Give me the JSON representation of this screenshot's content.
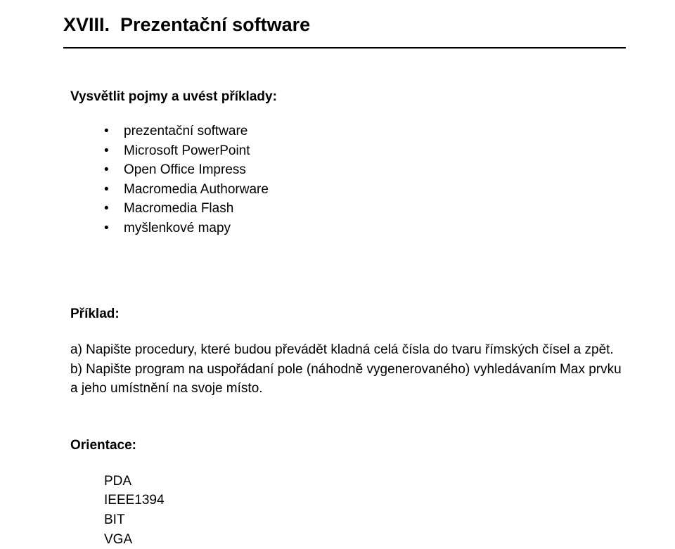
{
  "heading": "XVIII.  Prezentační software",
  "subheading": "Vysvětlit pojmy a uvést příklady:",
  "bullets": {
    "item0": "prezentační software",
    "item1": "Microsoft PowerPoint",
    "item2": "Open Office Impress",
    "item3": "Macromedia Authorware",
    "item4": "Macromedia Flash",
    "item5": "myšlenkové mapy"
  },
  "example": {
    "label": "Příklad:",
    "text_a": "a) Napište procedury, které budou převádět kladná celá čísla do tvaru římských čísel a zpět.",
    "text_b": "b) Napište program na uspořádaní pole (náhodně vygenerovaného) vyhledávaním Max prvku a jeho umístnění na svoje místo."
  },
  "orientation": {
    "label": "Orientace:",
    "items": {
      "i0": "PDA",
      "i1": "IEEE1394",
      "i2": "BIT",
      "i3": "VGA"
    }
  }
}
